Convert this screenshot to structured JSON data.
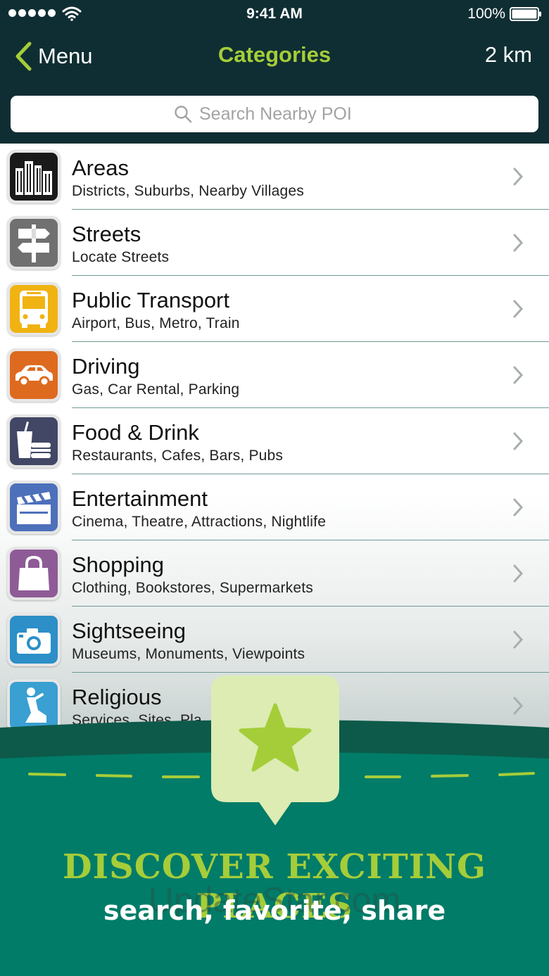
{
  "status_bar": {
    "time": "9:41 AM",
    "battery": "100%",
    "signal_icon": "signal-dots-icon",
    "wifi_icon": "wifi-icon",
    "battery_icon": "battery-icon"
  },
  "nav": {
    "back_label": "Menu",
    "title": "Categories",
    "range": "2 km"
  },
  "search": {
    "placeholder": "Search Nearby POI",
    "icon": "search-icon"
  },
  "categories": [
    {
      "title": "Areas",
      "subtitle": "Districts, Suburbs, Nearby Villages",
      "icon": "city-buildings-icon",
      "color": "#1a1a1a"
    },
    {
      "title": "Streets",
      "subtitle": "Locate Streets",
      "icon": "signpost-icon",
      "color": "#707070"
    },
    {
      "title": "Public Transport",
      "subtitle": "Airport, Bus, Metro, Train",
      "icon": "bus-icon",
      "color": "#f0b312"
    },
    {
      "title": "Driving",
      "subtitle": "Gas, Car Rental, Parking",
      "icon": "car-icon",
      "color": "#de6a1f"
    },
    {
      "title": "Food & Drink",
      "subtitle": "Restaurants, Cafes, Bars, Pubs",
      "icon": "drink-burger-icon",
      "color": "#414764"
    },
    {
      "title": "Entertainment",
      "subtitle": "Cinema, Theatre, Attractions, Nightlife",
      "icon": "clapperboard-icon",
      "color": "#4d70ba"
    },
    {
      "title": "Shopping",
      "subtitle": "Clothing, Bookstores, Supermarkets",
      "icon": "shopping-bag-icon",
      "color": "#8e5b96"
    },
    {
      "title": "Sightseeing",
      "subtitle": "Museums, Monuments, Viewpoints",
      "icon": "camera-icon",
      "color": "#2c8fc7"
    },
    {
      "title": "Religious",
      "subtitle": "Services, Sites, Pla",
      "icon": "praying-person-icon",
      "color": "#3a9fd1"
    }
  ],
  "banner": {
    "headline": "DISCOVER EXCITING PLACES",
    "tagline": "search, favorite, share",
    "watermark": "UpdateStar.com",
    "icon": "star-icon",
    "colors": {
      "green": "#007c68",
      "dark_green": "#0d5a4a",
      "accent": "#a5cd39",
      "bubble": "#dcecb3"
    }
  }
}
